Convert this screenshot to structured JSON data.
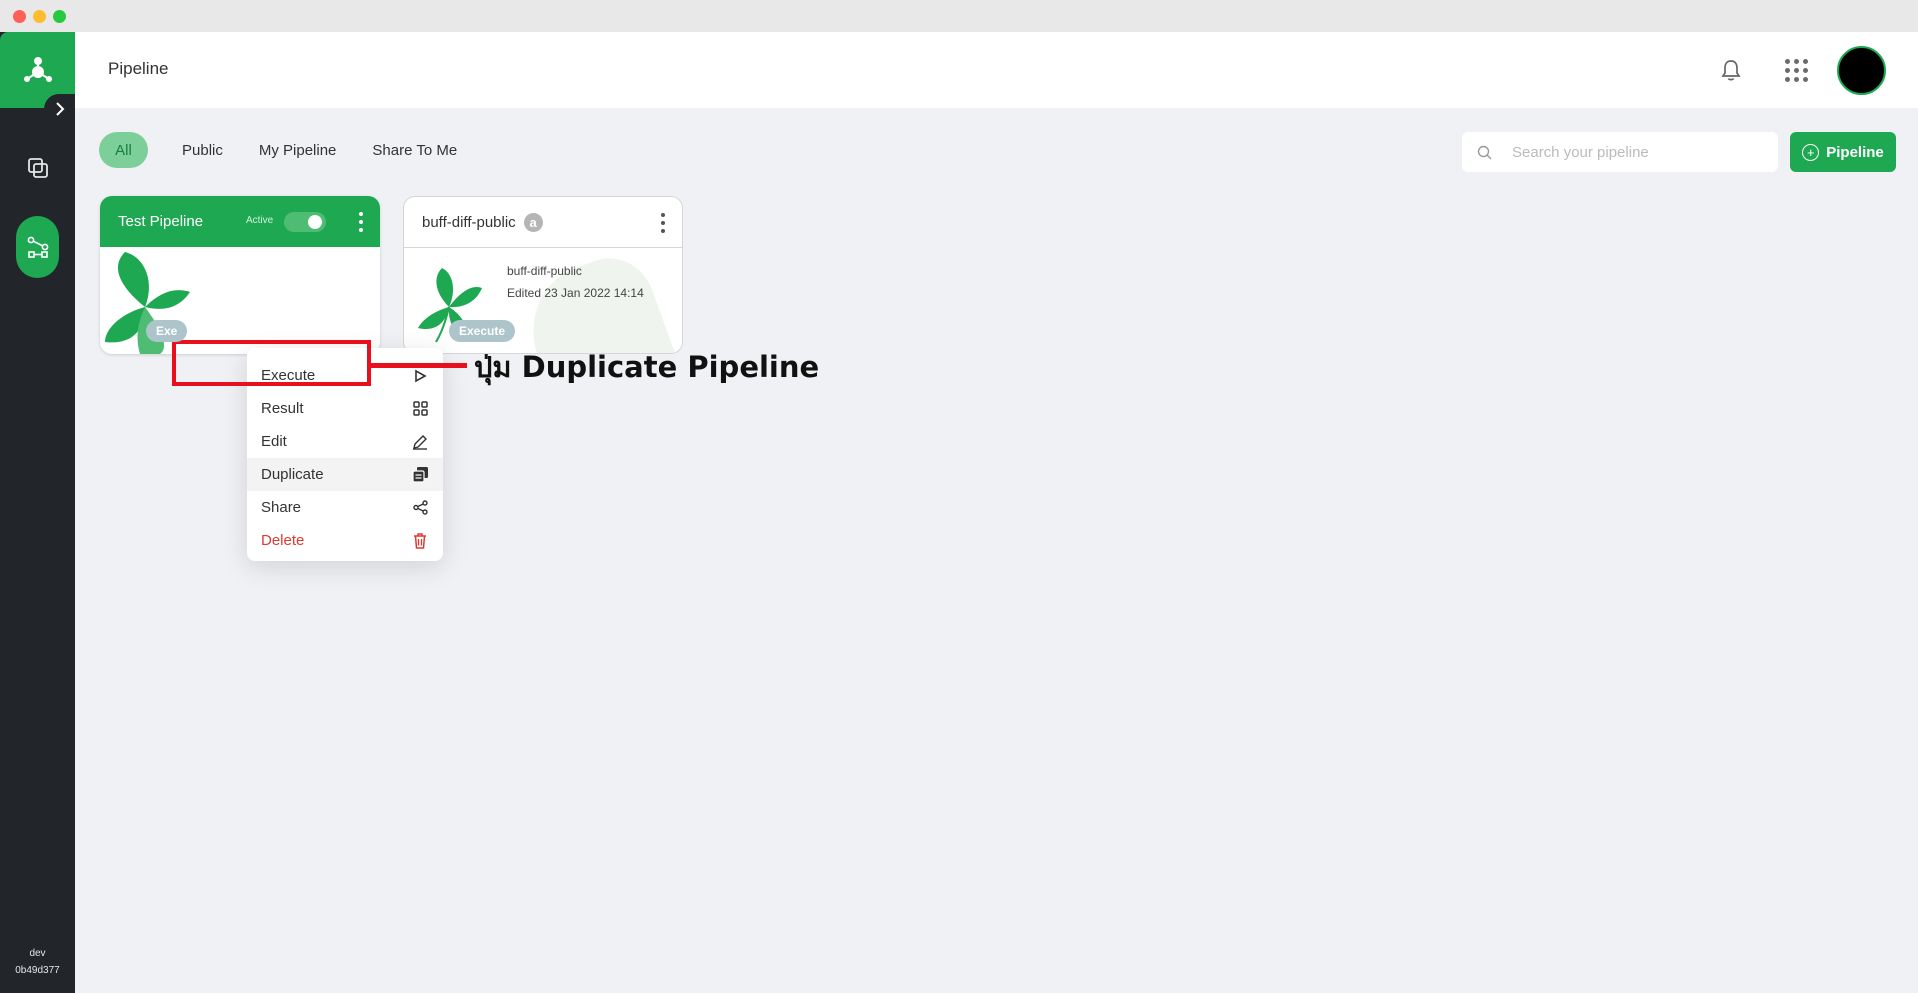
{
  "window": {
    "controls": [
      "close",
      "minimize",
      "maximize"
    ]
  },
  "sidebar": {
    "logo_icon": "app-logo-icon",
    "expand_icon": "chevron-right-icon",
    "items": [
      {
        "name": "dataset",
        "icon": "layers-icon"
      },
      {
        "name": "pipeline",
        "icon": "pipeline-flow-icon",
        "active": true
      }
    ],
    "footer": {
      "env": "dev",
      "version": "0b49d377"
    }
  },
  "header": {
    "title": "Pipeline",
    "notification_icon": "bell-icon",
    "apps_icon": "apps-grid-icon",
    "avatar_color": "#000000"
  },
  "filters": {
    "tabs": [
      {
        "label": "All",
        "active": true
      },
      {
        "label": "Public"
      },
      {
        "label": "My Pipeline"
      },
      {
        "label": "Share To Me"
      }
    ]
  },
  "search": {
    "placeholder": "Search your pipeline",
    "value": ""
  },
  "add_button": {
    "label": "Pipeline",
    "icon": "plus-circle-icon"
  },
  "cards": [
    {
      "title": "Test Pipeline",
      "status_label": "Active",
      "active": true,
      "execute_label": "Exe"
    },
    {
      "title": "buff-diff-public",
      "badge": "a",
      "name": "buff-diff-public",
      "edited": "Edited 23 Jan 2022 14:14",
      "execute_label": "Execute"
    }
  ],
  "menu": {
    "items": [
      {
        "label": "Execute",
        "icon": "play-icon"
      },
      {
        "label": "Result",
        "icon": "grid-icon"
      },
      {
        "label": "Edit",
        "icon": "pencil-icon"
      },
      {
        "label": "Duplicate",
        "icon": "copy-icon",
        "highlighted": true
      },
      {
        "label": "Share",
        "icon": "share-icon"
      },
      {
        "label": "Delete",
        "icon": "trash-icon",
        "danger": true
      }
    ]
  },
  "annotation": {
    "text": "ปุ่ม Duplicate Pipeline",
    "color": "#e8101d"
  },
  "colors": {
    "brand": "#1da851",
    "sidebar": "#22262a",
    "danger": "#e0382f"
  }
}
